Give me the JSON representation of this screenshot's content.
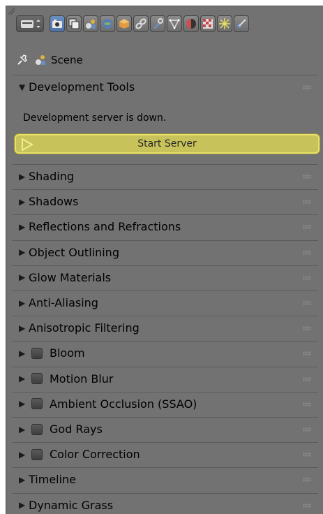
{
  "toolbar": {
    "icons": [
      "properties-editor-icon",
      "render-icon",
      "render-layers-icon",
      "scene-icon",
      "world-icon",
      "object-icon",
      "constraints-icon",
      "modifiers-icon",
      "data-icon",
      "material-icon",
      "texture-icon",
      "particles-icon",
      "physics-icon"
    ]
  },
  "context": {
    "scene_label": "Scene"
  },
  "dev_panel": {
    "title": "Development Tools",
    "status": "Development server is down.",
    "button_label": "Start Server"
  },
  "panels": [
    {
      "title": "Shading",
      "checkbox": false
    },
    {
      "title": "Shadows",
      "checkbox": false
    },
    {
      "title": "Reflections and Refractions",
      "checkbox": false
    },
    {
      "title": "Object Outlining",
      "checkbox": false
    },
    {
      "title": "Glow Materials",
      "checkbox": false
    },
    {
      "title": "Anti-Aliasing",
      "checkbox": false
    },
    {
      "title": "Anisotropic Filtering",
      "checkbox": false
    },
    {
      "title": "Bloom",
      "checkbox": true
    },
    {
      "title": "Motion Blur",
      "checkbox": true
    },
    {
      "title": "Ambient Occlusion (SSAO)",
      "checkbox": true
    },
    {
      "title": "God Rays",
      "checkbox": true
    },
    {
      "title": "Color Correction",
      "checkbox": true
    },
    {
      "title": "Timeline",
      "checkbox": false
    },
    {
      "title": "Dynamic Grass",
      "checkbox": false
    }
  ],
  "colors": {
    "panel_bg": "#727272",
    "button": "#c8c25a",
    "active_tab": "#5b82b5"
  }
}
